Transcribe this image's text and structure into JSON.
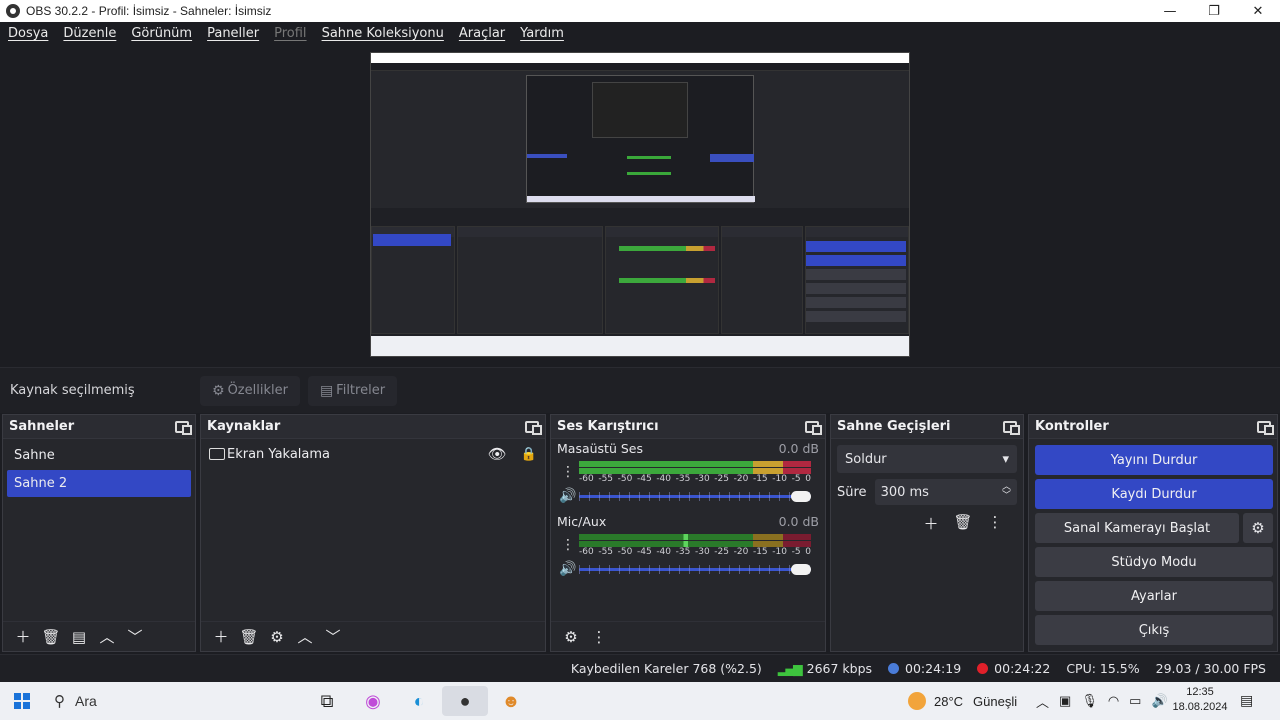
{
  "window": {
    "title": "OBS 30.2.2 - Profil: İsimsiz - Sahneler: İsimsiz",
    "minimize": "—",
    "maximize": "❐",
    "close": "✕"
  },
  "menu": [
    "Dosya",
    "Düzenle",
    "Görünüm",
    "Paneller",
    "Profil",
    "Sahne Koleksiyonu",
    "Araçlar",
    "Yardım"
  ],
  "source_bar": {
    "no_source": "Kaynak seçilmemiş",
    "properties": "Özellikler",
    "filters": "Filtreler"
  },
  "scenes": {
    "title": "Sahneler",
    "items": [
      "Sahne",
      "Sahne 2"
    ],
    "selected": "Sahne 2"
  },
  "sources": {
    "title": "Kaynaklar",
    "items": [
      "Ekran Yakalama"
    ]
  },
  "mixer": {
    "title": "Ses Karıştırıcı",
    "channels": [
      {
        "name": "Masaüstü Ses",
        "db": "0.0 dB"
      },
      {
        "name": "Mic/Aux",
        "db": "0.0 dB"
      }
    ],
    "scale": [
      "-60",
      "-55",
      "-50",
      "-45",
      "-40",
      "-35",
      "-30",
      "-25",
      "-20",
      "-15",
      "-10",
      "-5",
      "0"
    ]
  },
  "transitions": {
    "title": "Sahne Geçişleri",
    "selected": "Soldur",
    "duration_label": "Süre",
    "duration_value": "300 ms"
  },
  "controls": {
    "title": "Kontroller",
    "stop_stream": "Yayını Durdur",
    "stop_record": "Kaydı Durdur",
    "virtual_cam": "Sanal Kamerayı Başlat",
    "studio_mode": "Stüdyo Modu",
    "settings": "Ayarlar",
    "exit": "Çıkış"
  },
  "status": {
    "dropped": "Kaybedilen Kareler 768 (%2.5)",
    "bitrate": "2667 kbps",
    "stream_time": "00:24:19",
    "record_time": "00:24:22",
    "cpu": "CPU: 15.5%",
    "fps": "29.03 / 30.00 FPS"
  },
  "taskbar": {
    "search": "Ara",
    "weather": "28°C",
    "weather_desc": "Güneşli",
    "time": "12:35",
    "date": "18.08.2024"
  },
  "colors": {
    "accent": "#3348c5",
    "meter_green": "#3ca83c",
    "meter_yellow": "#c8a030",
    "meter_red": "#b02840"
  }
}
